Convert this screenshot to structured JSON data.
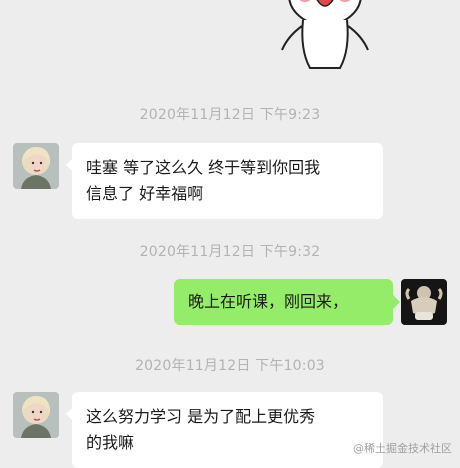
{
  "colors": {
    "background": "#ededed",
    "incoming": "#ffffff",
    "outgoing": "#95ec69"
  },
  "messages": [
    {
      "timestamp": "2020年11月12日 下午9:23",
      "sender": "contact",
      "lines": [
        "哇塞  等了这么久 终于等到你回我",
        "信息了 好幸福啊"
      ]
    },
    {
      "timestamp": "2020年11月12日 下午9:32",
      "sender": "me",
      "lines": [
        "晚上在听课，刚回来，"
      ]
    },
    {
      "timestamp": "2020年11月12日 下午10:03",
      "sender": "contact",
      "lines": [
        "这么努力学习 是为了配上更优秀",
        "的我嘛"
      ]
    }
  ],
  "sticker": {
    "icon": "cartoon-character-sticker"
  },
  "avatars": {
    "contact": "blonde-woman-avatar",
    "me": "baby-avatar"
  },
  "watermark": "@稀土掘金技术社区"
}
